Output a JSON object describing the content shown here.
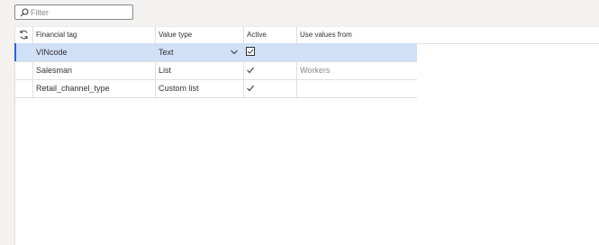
{
  "filter": {
    "placeholder": "Filter",
    "value": ""
  },
  "columns": [
    "Financial tag",
    "Value type",
    "Active",
    "Use values from"
  ],
  "rows": [
    {
      "financial_tag": "VINcode",
      "value_type": "Text",
      "active": true,
      "use_values_from": "",
      "selected": true,
      "value_type_dropdown": true
    },
    {
      "financial_tag": "Salesman",
      "value_type": "List",
      "active": true,
      "use_values_from": "Workers",
      "selected": false
    },
    {
      "financial_tag": "Retail_channel_type",
      "value_type": "Custom list",
      "active": true,
      "use_values_from": "",
      "selected": false
    }
  ],
  "colors": {
    "accent": "#2266e3",
    "selected_row": "#cfe0f7",
    "border": "#e1dfdd",
    "muted_text": "#8a8886"
  },
  "icons": {
    "filter": "search-icon",
    "refresh": "refresh-icon",
    "dropdown": "chevron-down-icon",
    "active": "checkmark-icon"
  }
}
